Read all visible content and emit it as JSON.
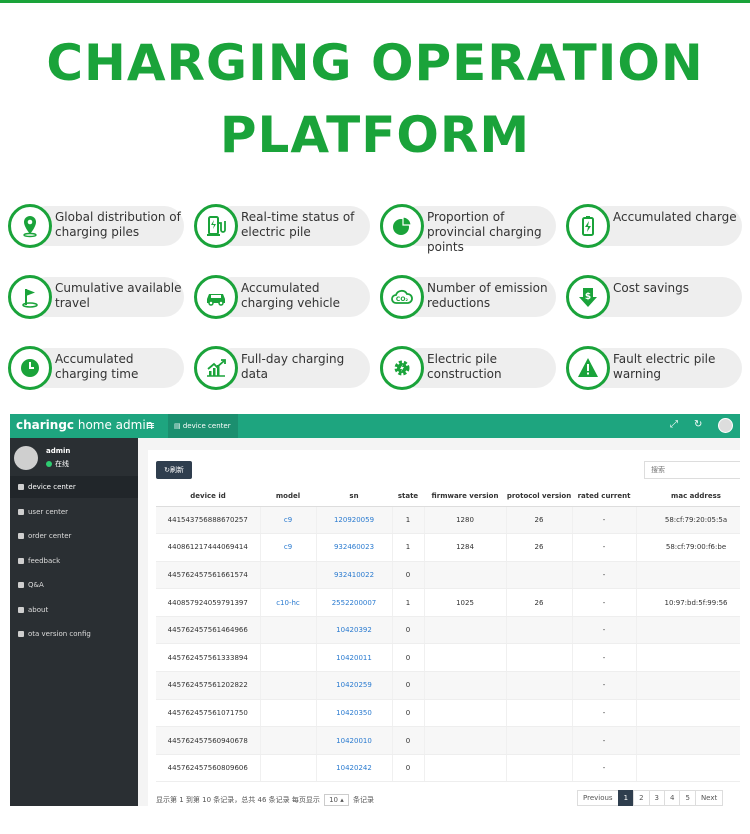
{
  "colors": {
    "brand_green": "#1aa33a",
    "admin_green": "#1ea57f",
    "sidebar_bg": "#2a2f33",
    "link_blue": "#2b7bd0"
  },
  "title": {
    "line1": "CHARGING OPERATION",
    "line2": "PLATFORM"
  },
  "features": [
    {
      "icon": "map-pin-icon",
      "label": "Global distribution of charging piles"
    },
    {
      "icon": "charger-icon",
      "label": "Real-time status of electric pile"
    },
    {
      "icon": "pie-chart-icon",
      "label": "Proportion of provincial charging points"
    },
    {
      "icon": "battery-icon",
      "label": "Accumulated charge"
    },
    {
      "icon": "flag-icon",
      "label": "Cumulative available travel"
    },
    {
      "icon": "car-icon",
      "label": "Accumulated charging vehicle"
    },
    {
      "icon": "co2-cloud-icon",
      "label": "Number of emission reductions"
    },
    {
      "icon": "dollar-down-icon",
      "label": "Cost savings"
    },
    {
      "icon": "clock-icon",
      "label": "Accumulated charging time"
    },
    {
      "icon": "chart-up-icon",
      "label": "Full-day charging data"
    },
    {
      "icon": "gear-icon",
      "label": "Electric pile construction"
    },
    {
      "icon": "warning-icon",
      "label": "Fault electric pile warning"
    }
  ],
  "admin": {
    "brand_bold": "charingc",
    "brand_rest": " home admin",
    "menu_glyph": "≡",
    "tab_label": "device center",
    "toolbar_icons": [
      "expand-icon",
      "refresh-icon",
      "avatar"
    ],
    "user": {
      "name": "admin",
      "status": "在线"
    },
    "sidebar": [
      {
        "label": "device center",
        "active": true
      },
      {
        "label": "user center"
      },
      {
        "label": "order center"
      },
      {
        "label": "feedback"
      },
      {
        "label": "Q&A"
      },
      {
        "label": "about"
      },
      {
        "label": "ota version config"
      }
    ],
    "refresh_label": "刷新",
    "search_placeholder": "搜索",
    "columns": [
      "device id",
      "model",
      "sn",
      "state",
      "firmware version",
      "protocol version",
      "rated current",
      "mac address"
    ],
    "rows": [
      [
        "441543756888670257",
        "c9",
        "120920059",
        "1",
        "1280",
        "26",
        "-",
        "58:cf:79:20:05:5a"
      ],
      [
        "440861217444069414",
        "c9",
        "932460023",
        "1",
        "1284",
        "26",
        "-",
        "58:cf:79:00:f6:be"
      ],
      [
        "445762457561661574",
        "",
        "932410022",
        "0",
        "",
        "",
        "-",
        ""
      ],
      [
        "440857924059791397",
        "c10-hc",
        "2552200007",
        "1",
        "1025",
        "26",
        "-",
        "10:97:bd:5f:99:56"
      ],
      [
        "445762457561464966",
        "",
        "10420392",
        "0",
        "",
        "",
        "-",
        ""
      ],
      [
        "445762457561333894",
        "",
        "10420011",
        "0",
        "",
        "",
        "-",
        ""
      ],
      [
        "445762457561202822",
        "",
        "10420259",
        "0",
        "",
        "",
        "-",
        ""
      ],
      [
        "445762457561071750",
        "",
        "10420350",
        "0",
        "",
        "",
        "-",
        ""
      ],
      [
        "445762457560940678",
        "",
        "10420010",
        "0",
        "",
        "",
        "-",
        ""
      ],
      [
        "445762457560809606",
        "",
        "10420242",
        "0",
        "",
        "",
        "-",
        ""
      ]
    ],
    "footer": {
      "before": "显示第 1 到第 10 条记录，总共 46 条记录 每页显示",
      "page_size": "10 ▴",
      "after": "条记录"
    },
    "pager": [
      "Previous",
      "1",
      "2",
      "3",
      "4",
      "5",
      "Next"
    ],
    "current_page": "1"
  }
}
